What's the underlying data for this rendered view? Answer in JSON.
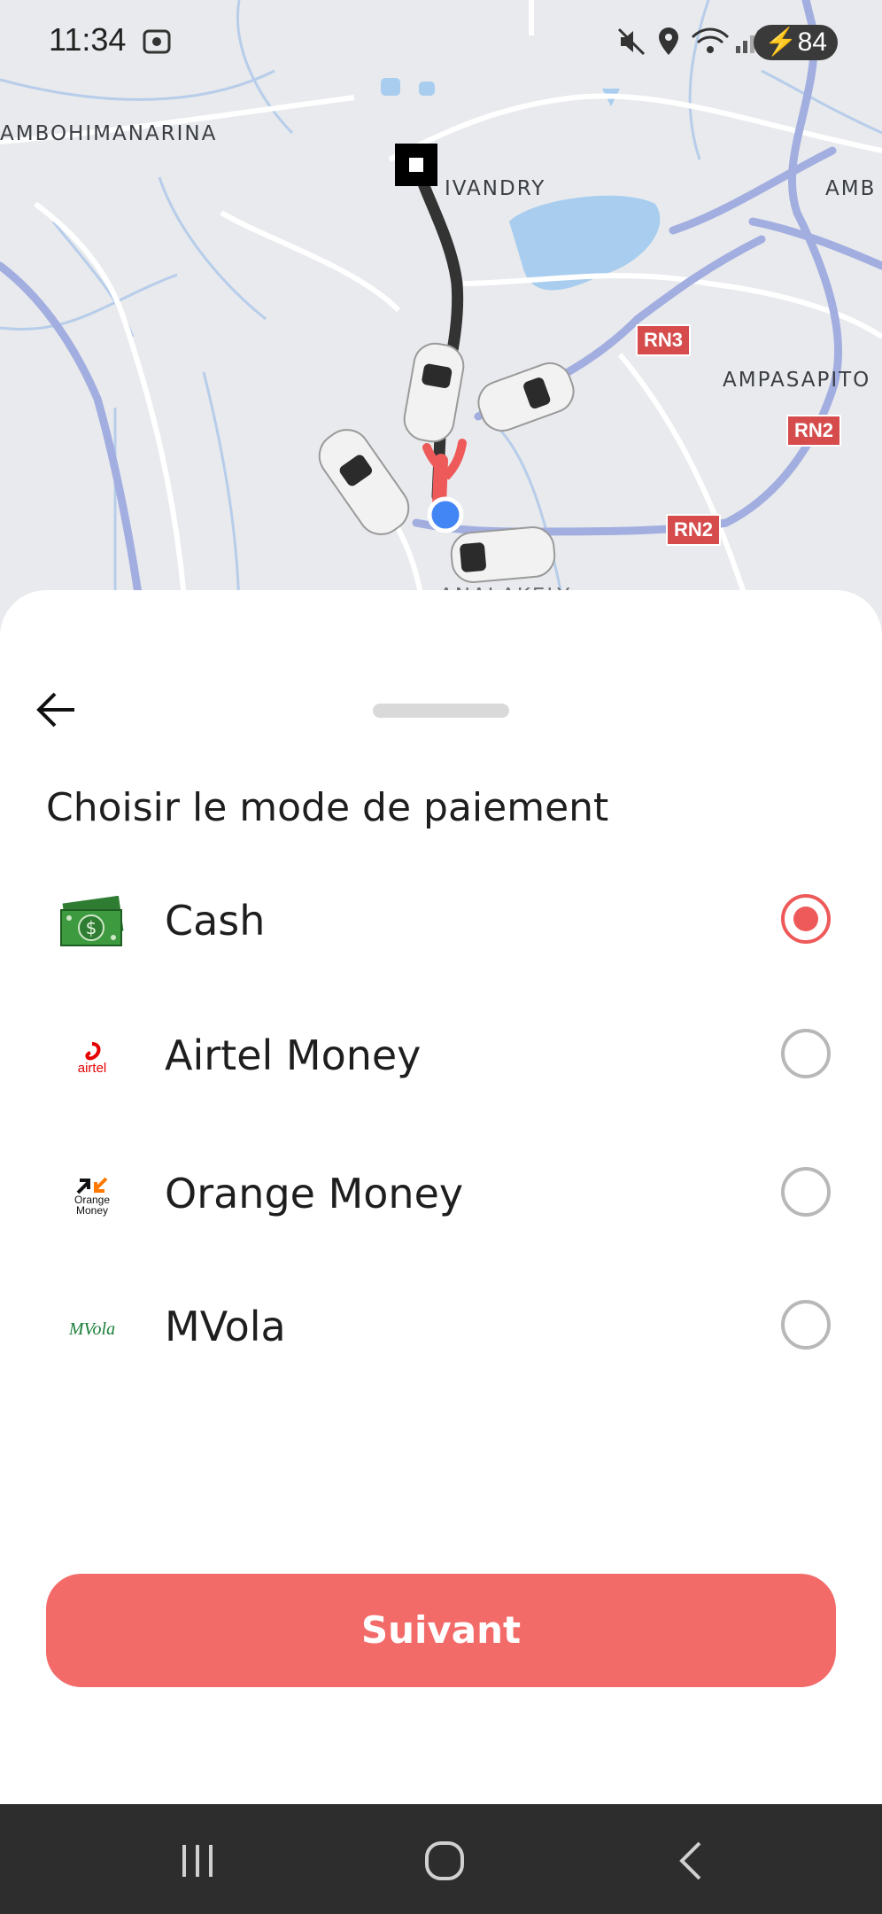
{
  "status_bar": {
    "time": "11:34",
    "battery": "84",
    "icons": [
      "screenshot-icon",
      "mute-icon",
      "location-icon",
      "wifi-icon",
      "signal-icon",
      "battery-charging-icon"
    ]
  },
  "map": {
    "places": [
      "AMBOHIMANARINA",
      "IVANDRY",
      "AMB",
      "AMPASAPITO",
      "ANALAKELY"
    ],
    "road_shields": [
      "RN3",
      "RN2",
      "RN2"
    ],
    "colors": {
      "background": "#e8eaed",
      "water": "#a8cdef",
      "major_road": "#a2aee0",
      "route": "#333333",
      "route_end": "#ee5a5a",
      "user_location": "#4285f4"
    }
  },
  "sheet": {
    "title": "Choisir le mode de paiement",
    "options": [
      {
        "label": "Cash",
        "logo": "cash-icon",
        "selected": true
      },
      {
        "label": "Airtel Money",
        "logo": "airtel-logo",
        "logo_text": "airtel",
        "selected": false
      },
      {
        "label": "Orange Money",
        "logo": "orange-money-logo",
        "logo_text": "Orange Money",
        "selected": false
      },
      {
        "label": "MVola",
        "logo": "mvola-logo",
        "logo_text": "MVola",
        "selected": false
      }
    ],
    "next_label": "Suivant"
  },
  "colors": {
    "accent": "#f36b69",
    "radio_selected": "#ee5a5a",
    "nav_bar": "#2d2d2d"
  },
  "nav_bar": {
    "buttons": [
      "recent-apps-icon",
      "home-icon",
      "back-icon"
    ]
  }
}
